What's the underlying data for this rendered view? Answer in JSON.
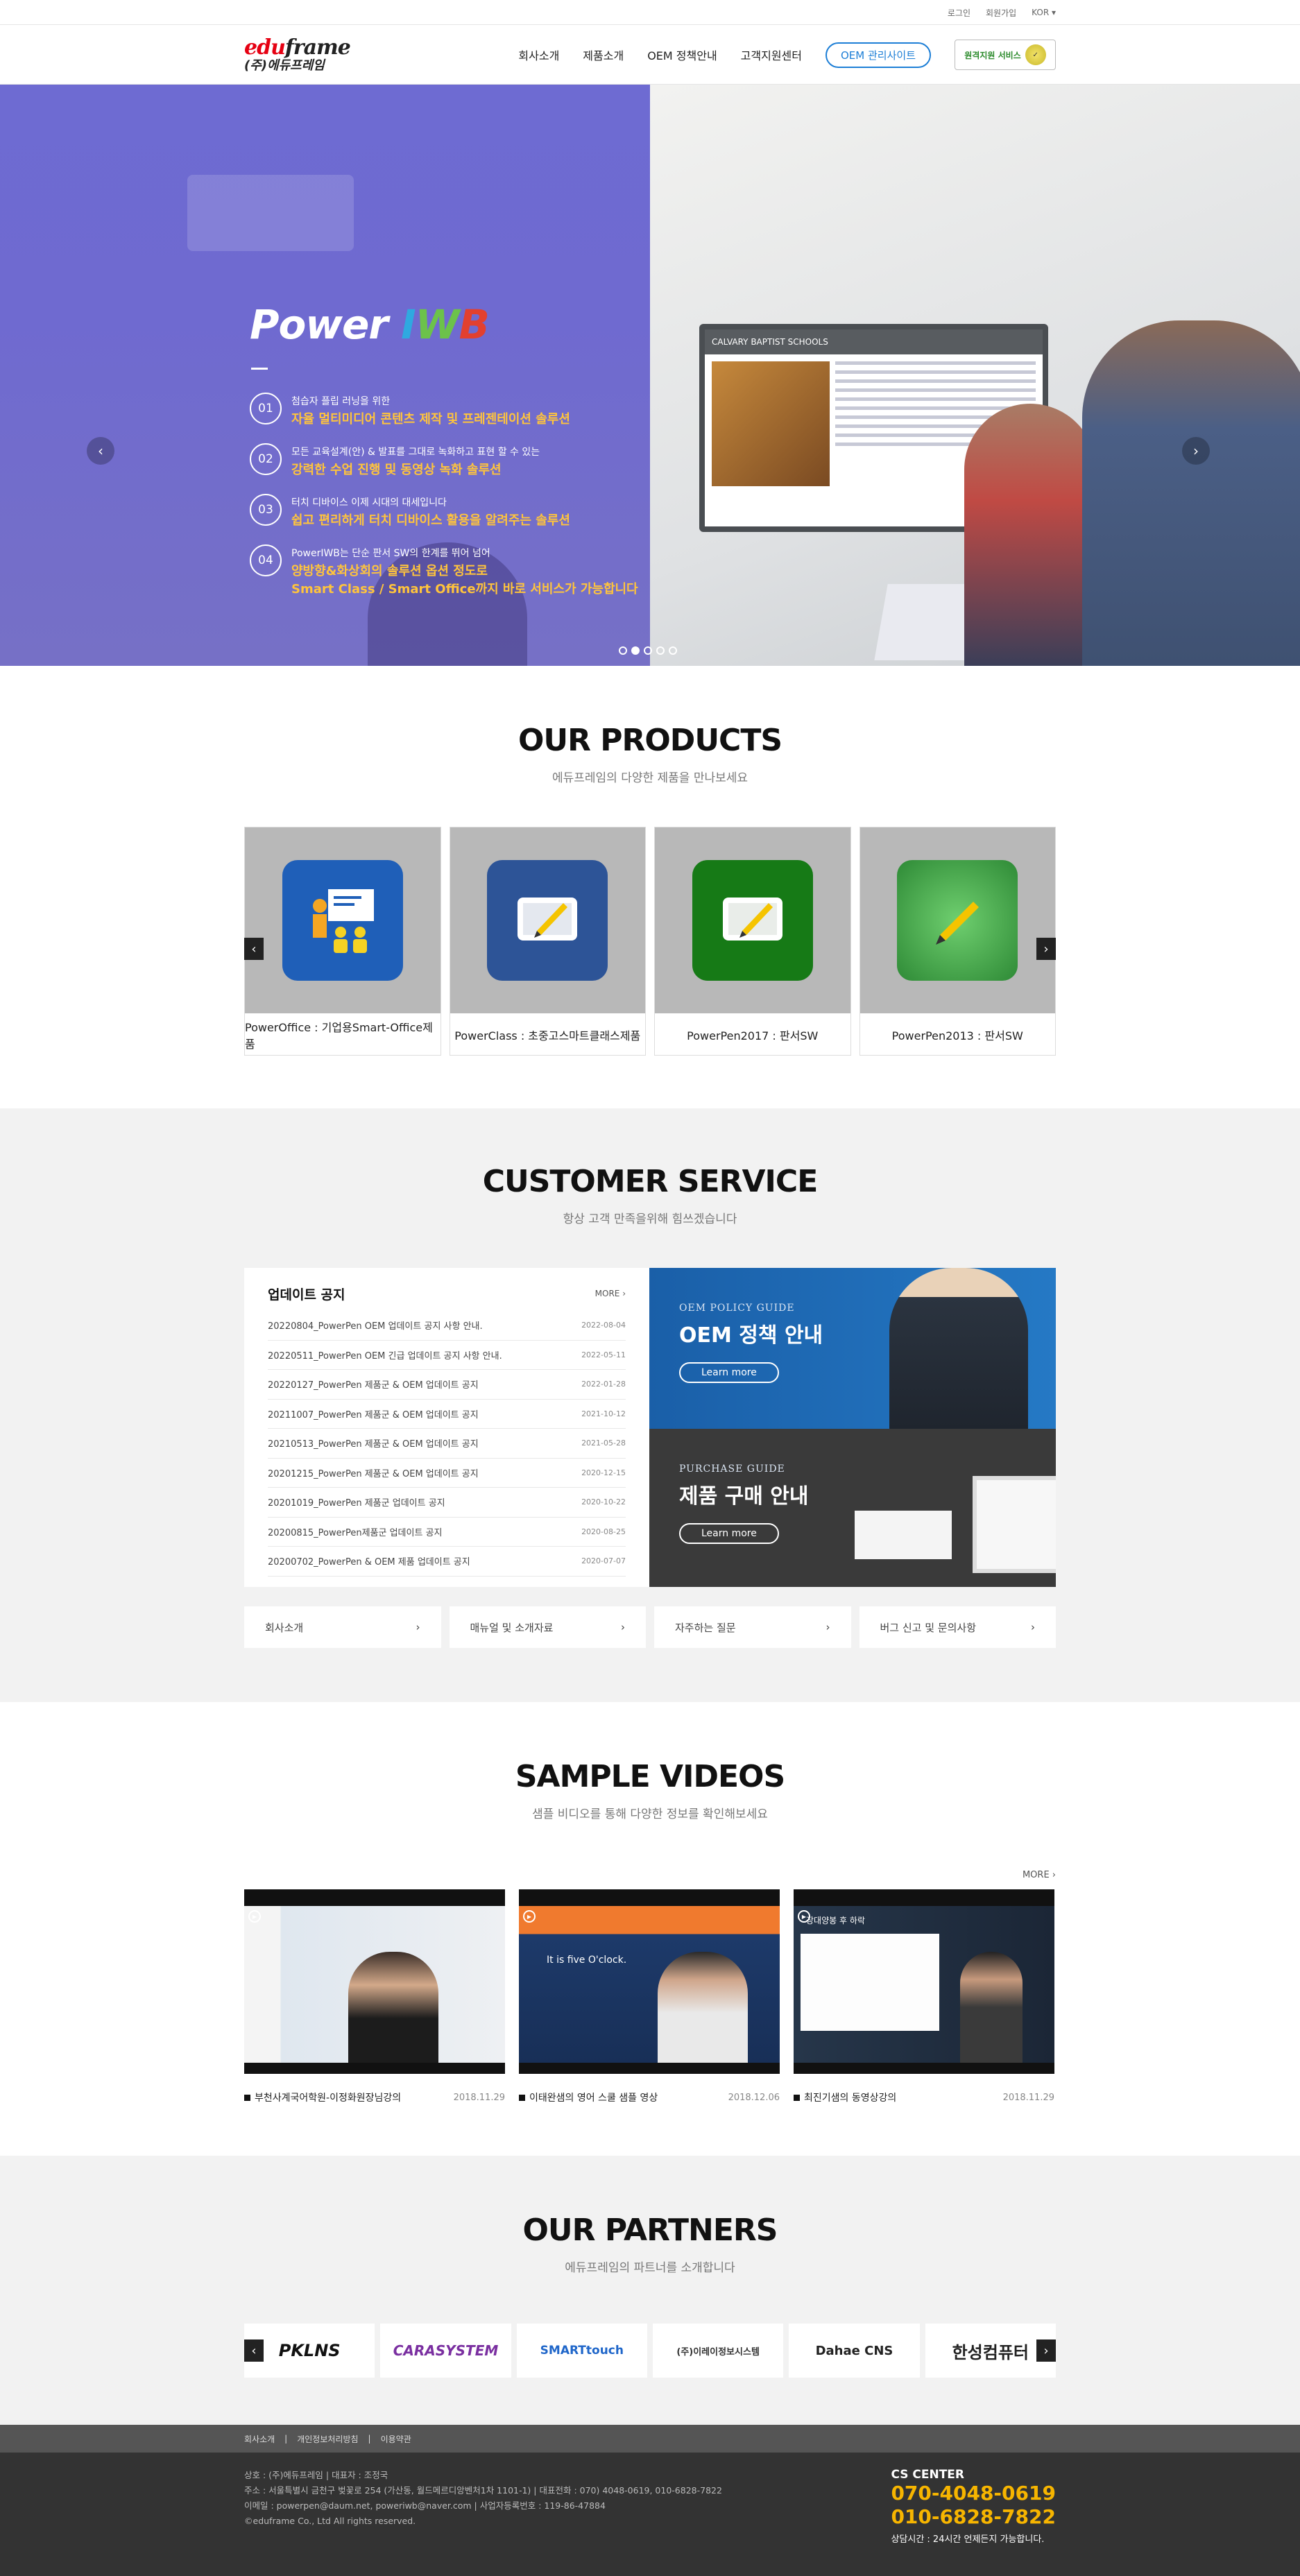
{
  "topbar": {
    "login": "로그인",
    "join": "회원가입",
    "lang": "KOR ▾"
  },
  "header": {
    "logo_en_a": "edu",
    "logo_en_b": "frame",
    "logo_ko": "(주)에듀프레임",
    "nav": [
      "회사소개",
      "제품소개",
      "OEM 정책안내",
      "고객지원센터"
    ],
    "oem_site": "OEM 관리사이트",
    "remote": "원격지원 서비스"
  },
  "hero": {
    "title_a": "Power ",
    "title_i": "I",
    "title_w": "W",
    "title_b": "B",
    "board_title": "CALVARY BAPTIST SCHOOLS",
    "features": [
      {
        "num": "01",
        "small": "첨습자 플립 러닝을 위한",
        "big": "자율 멀티미디어 콘텐츠 제작 및 프레젠테이션 솔루션"
      },
      {
        "num": "02",
        "small": "모든 교육설계(안) & 발표를 그대로 녹화하고 표현 할 수 있는",
        "big": "강력한 수업 진행 및 동영상 녹화 솔루션"
      },
      {
        "num": "03",
        "small": "터치 디바이스 이제 시대의 대세입니다",
        "big": "쉽고 편리하게 터치 디바이스 활용을 알려주는 솔루션"
      },
      {
        "num": "04",
        "small": "PowerIWB는 단순 판서 SW의 한계를 뛰어 넘어",
        "big": "양방향&화상회의 솔루션 옵션 정도로",
        "big2": "Smart Class / Smart Office까지 바로 서비스가 가능합니다"
      }
    ],
    "prev": "‹",
    "next": "›"
  },
  "products": {
    "title": "OUR PRODUCTS",
    "sub": "에듀프레임의 다양한 제품을 만나보세요",
    "items": [
      {
        "label": "PowerOffice : 기업용Smart-Office제품",
        "icon": "presentation-icon",
        "color": "#1f5fb8"
      },
      {
        "label": "PowerClass : 초중고스마트클래스제품",
        "icon": "pen-tablet-icon",
        "color": "#2d5497"
      },
      {
        "label": "PowerPen2017 : 판서SW",
        "icon": "pen-tablet-icon",
        "color": "#167a16"
      },
      {
        "label": "PowerPen2013 : 판서SW",
        "icon": "pen-tablet-icon",
        "color": "#2e8a36"
      }
    ]
  },
  "customer": {
    "title": "CUSTOMER SERVICE",
    "sub": "항상 고객 만족을위해 힘쓰겠습니다",
    "notice_title": "업데이트 공지",
    "more": "MORE ›",
    "notices": [
      {
        "t": "20220804_PowerPen OEM 업데이트 공지 사항 안내.",
        "d": "2022-08-04"
      },
      {
        "t": "20220511_PowerPen OEM 긴급 업데이트 공지 사항 안내.",
        "d": "2022-05-11"
      },
      {
        "t": "20220127_PowerPen 제품군 & OEM 업데이트 공지",
        "d": "2022-01-28"
      },
      {
        "t": "20211007_PowerPen 제품군 & OEM 업데이트 공지",
        "d": "2021-10-12"
      },
      {
        "t": "20210513_PowerPen 제품군 & OEM 업데이트 공지",
        "d": "2021-05-28"
      },
      {
        "t": "20201215_PowerPen 제품군 & OEM 업데이트 공지",
        "d": "2020-12-15"
      },
      {
        "t": "20201019_PowerPen 제품군 업데이트 공지",
        "d": "2020-10-22"
      },
      {
        "t": "20200815_PowerPen제품군 업데이트 공지",
        "d": "2020-08-25"
      },
      {
        "t": "20200702_PowerPen & OEM 제품 업데이트 공지",
        "d": "2020-07-07"
      }
    ],
    "guide1_en": "OEM POLICY GUIDE",
    "guide1_ko": "OEM 정책 안내",
    "guide2_en": "PURCHASE GUIDE",
    "guide2_ko": "제품 구매 안내",
    "learn": "Learn more",
    "links": [
      "회사소개",
      "매뉴얼 및 소개자료",
      "자주하는 질문",
      "버그 신고 및 문의사항"
    ]
  },
  "videos": {
    "title": "SAMPLE VIDEOS",
    "sub": "샘플 비디오를 통해 다양한 정보를 확인해보세요",
    "more": "MORE ›",
    "items": [
      {
        "title": "부천사계국어학원-이정화원장님강의",
        "date": "2018.11.29"
      },
      {
        "title": "이태완샘의 영어 스쿨 샘플 영상",
        "date": "2018.12.06"
      },
      {
        "title": "최진기샘의 동영상강의",
        "date": "2018.11.29"
      }
    ],
    "v2_caption": "It is five O'clock.",
    "v3_caption": "장대양봉 후 하락"
  },
  "partners": {
    "title": "OUR PARTNERS",
    "sub": "에듀프레임의 파트너를 소개합니다",
    "logos": [
      "PKLNS",
      "CARASYSTEM",
      "SMARTtouch",
      "(주)이레이정보시스템",
      "Dahae CNS",
      "한성컴퓨터"
    ]
  },
  "footer": {
    "links": [
      "회사소개",
      "개인정보처리방침",
      "이용약관"
    ],
    "info": [
      "상호 : (주)에듀프레임    |    대표자 : 조정국",
      "주소 : 서울특별시 금천구 벚꽃로 254 (가산동, 월드메르디앙벤처1차 1101-1)    |    대표전화 : 070) 4048-0619, 010-6828-7822",
      "이메일 : powerpen@daum.net, poweriwb@naver.com    |    사업자등록번호 : 119-86-47884",
      "©eduframe Co., Ltd All rights reserved."
    ],
    "cs_title": "CS CENTER",
    "phone1": "070-4048-0619",
    "phone2": "010-6828-7822",
    "hours": "상담시간 : 24시간 언제든지 가능합니다."
  },
  "colors": {
    "accent": "#1c7ed6",
    "hero_purple": "#6e6bd2",
    "hero_yellow": "#ffc43c",
    "phone": "#f7b500"
  }
}
